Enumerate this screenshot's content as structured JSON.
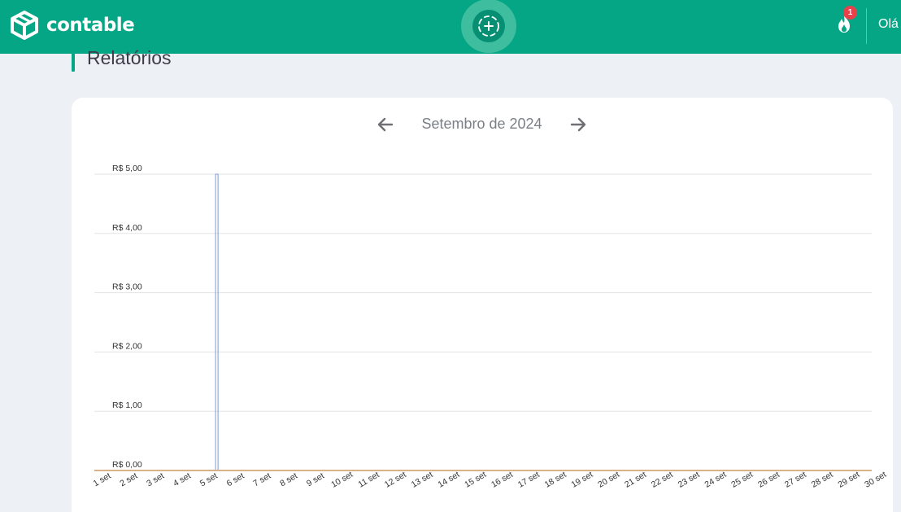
{
  "brand": {
    "name": "contable",
    "logo_icon": "box-logo-icon"
  },
  "header": {
    "add_icon": "plus-circle-icon",
    "notification_icon": "flame-icon",
    "notification_count": "1",
    "greeting": "Olá",
    "colors": {
      "bar": "#05a685",
      "badge": "#e8414b"
    }
  },
  "page": {
    "title": "Relatórios"
  },
  "report": {
    "month_label": "Setembro de 2024",
    "prev_icon": "arrow-left-icon",
    "next_icon": "arrow-right-icon"
  },
  "chart_data": {
    "type": "bar",
    "title": "",
    "xlabel": "",
    "ylabel": "",
    "ylim": [
      0,
      5
    ],
    "yticks": [
      "R$ 0,00",
      "R$ 1,00",
      "R$ 2,00",
      "R$ 3,00",
      "R$ 4,00",
      "R$ 5,00"
    ],
    "categories": [
      "1 set",
      "2 set",
      "3 set",
      "4 set",
      "5 set",
      "6 set",
      "7 set",
      "8 set",
      "9 set",
      "10 set",
      "11 set",
      "12 set",
      "13 set",
      "14 set",
      "15 set",
      "16 set",
      "17 set",
      "18 set",
      "19 set",
      "20 set",
      "21 set",
      "22 set",
      "23 set",
      "24 set",
      "25 set",
      "26 set",
      "27 set",
      "28 set",
      "29 set",
      "30 set"
    ],
    "series": [
      {
        "values": [
          0,
          0,
          0,
          0,
          5,
          0,
          0,
          0,
          0,
          0,
          0,
          0,
          0,
          0,
          0,
          0,
          0,
          0,
          0,
          0,
          0,
          0,
          0,
          0,
          0,
          0,
          0,
          0,
          0,
          0
        ],
        "color": "#7a9bd6"
      }
    ],
    "grid": true,
    "baseline_color": "#d9b28c"
  }
}
